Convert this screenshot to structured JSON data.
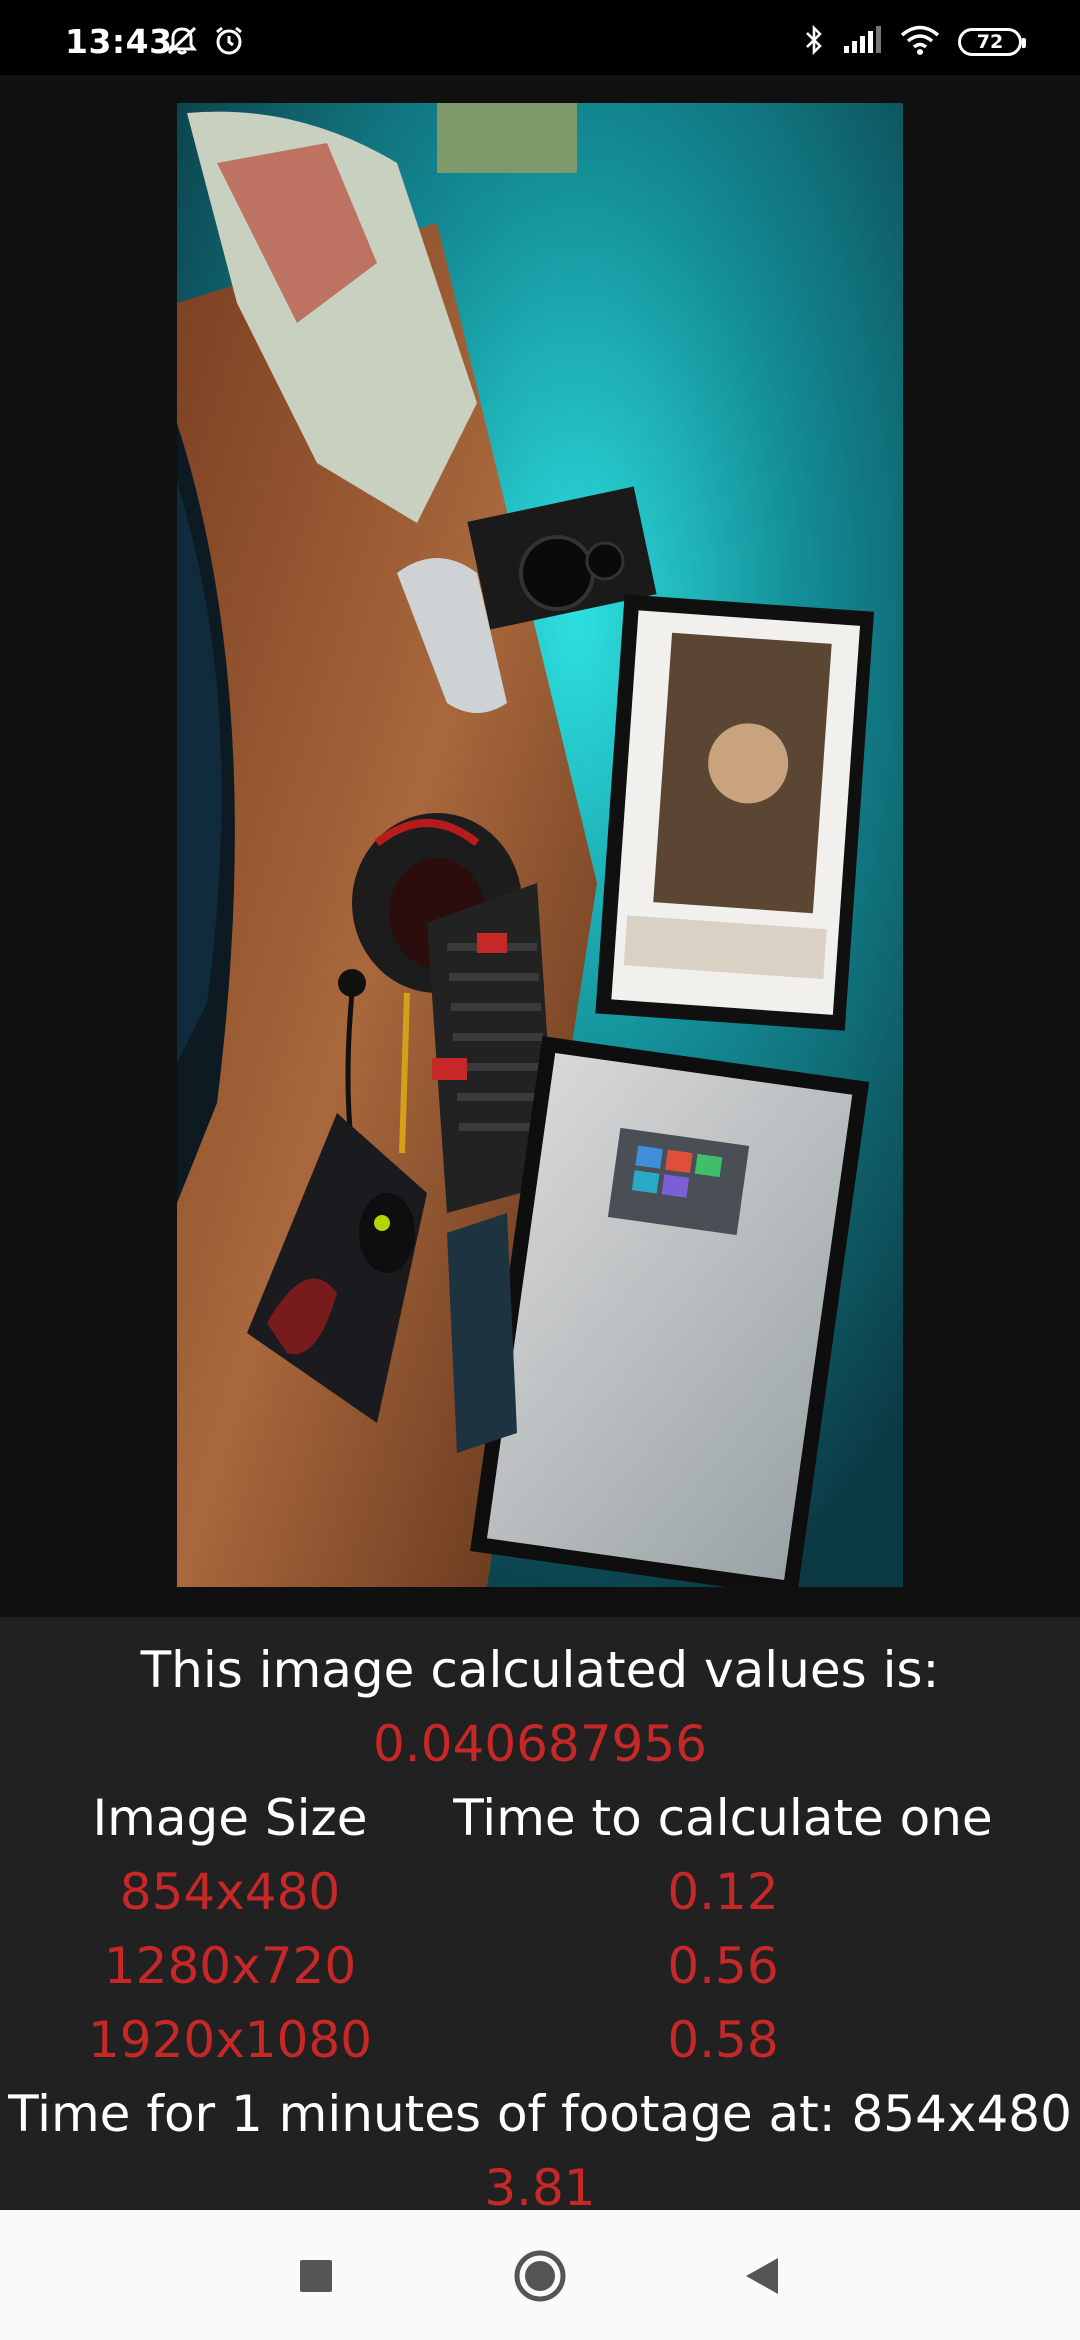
{
  "status_bar": {
    "time": "13:43",
    "battery": "72",
    "left_icons": [
      "bell-off-icon",
      "alarm-icon"
    ],
    "right_icons": [
      "bluetooth-icon",
      "signal-icon",
      "wifi-icon",
      "battery-icon"
    ]
  },
  "photo": {
    "subject": "desk setup photo"
  },
  "results": {
    "heading": "This image calculated values is:",
    "value": "0.040687956",
    "col_size_header": "Image Size",
    "col_time_header": "Time to calculate one",
    "rows": [
      {
        "size": "854x480",
        "time": "0.12"
      },
      {
        "size": "1280x720",
        "time": "0.56"
      },
      {
        "size": "1920x1080",
        "time": "0.58"
      }
    ],
    "footage_label": "Time for 1 minutes of footage at: 854x480",
    "footage_value": "3.81"
  },
  "nav_bar": {
    "icons": [
      "recents-square-icon",
      "home-circle-icon",
      "back-triangle-icon"
    ]
  },
  "colors": {
    "value_red": "#c62828",
    "results_bg": "#212121",
    "image_bg": "#101010"
  }
}
